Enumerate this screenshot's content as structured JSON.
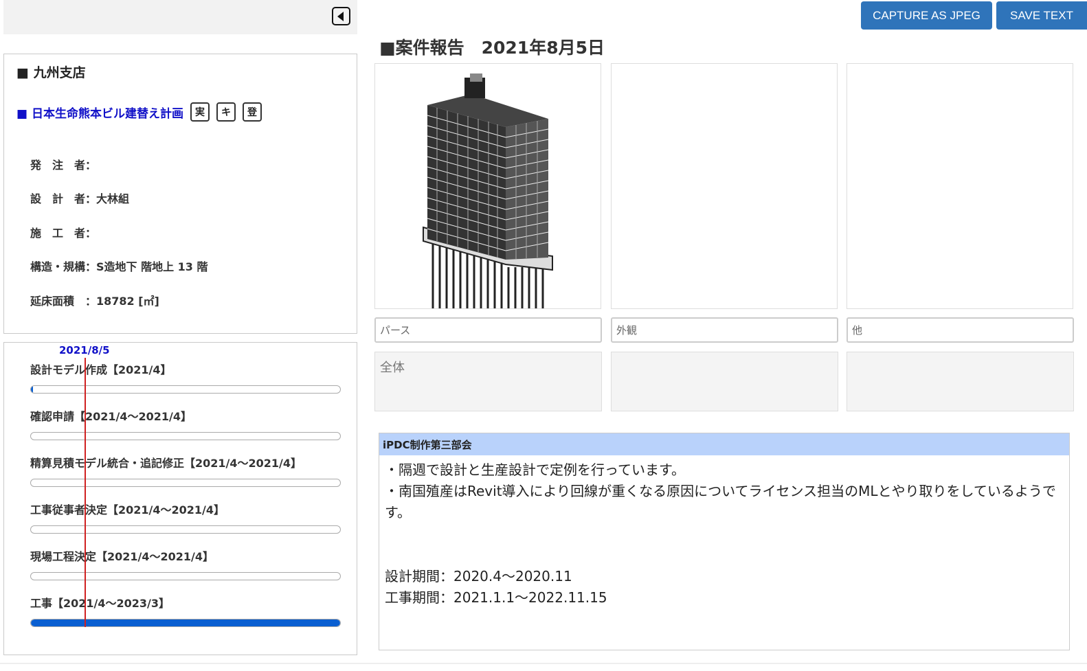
{
  "sidebar": {
    "collapse_icon": "collapse-left-icon",
    "branch": "■ 九州支店",
    "project": {
      "name": "■ 日本生命熊本ビル建替え計画",
      "tags": [
        "実",
        "キ",
        "登"
      ]
    },
    "fields": [
      {
        "text": "発　注　者："
      },
      {
        "text": "設　計　者：大林組"
      },
      {
        "text": "施　工　者："
      },
      {
        "text": "構造・規構：S造地下 階地上 13 階"
      },
      {
        "text": "延床面積　：18782 [㎡]"
      }
    ]
  },
  "schedule": {
    "today_label": "2021/8/5",
    "tasks": [
      {
        "label": "設計モデル作成【2021/4】",
        "progress": 0.005
      },
      {
        "label": "確認申請【2021/4～2021/4】",
        "progress": 0
      },
      {
        "label": "精算見積モデル統合・追記修正【2021/4～2021/4】",
        "progress": 0
      },
      {
        "label": "工事従事者決定【2021/4～2021/4】",
        "progress": 0
      },
      {
        "label": "現場工程決定【2021/4～2021/4】",
        "progress": 0
      },
      {
        "label": "工事【2021/4～2023/3】",
        "progress": 1.0
      }
    ],
    "colors": {
      "bar": "#0a5fd1",
      "today_line": "#d02020"
    }
  },
  "toolbar": {
    "capture_label": "CAPTURE AS JPEG",
    "save_label": "SAVE TEXT"
  },
  "report": {
    "title": "■案件報告　2021年8月5日",
    "photos": [
      {
        "caption": "パース",
        "note": "全体"
      },
      {
        "caption": "外観",
        "note": ""
      },
      {
        "caption": "他",
        "note": ""
      }
    ]
  },
  "meeting": {
    "header": "iPDC制作第三部会",
    "body": "・隔週で設計と生産設計で定例を行っています。\n・南国殖産はRevit導入により回線が重くなる原因についてライセンス担当のMLとやり取りをしているようです。\n\n\n設計期間：2020.4～2020.11\n工事期間：2021.1.1～2022.11.15"
  }
}
